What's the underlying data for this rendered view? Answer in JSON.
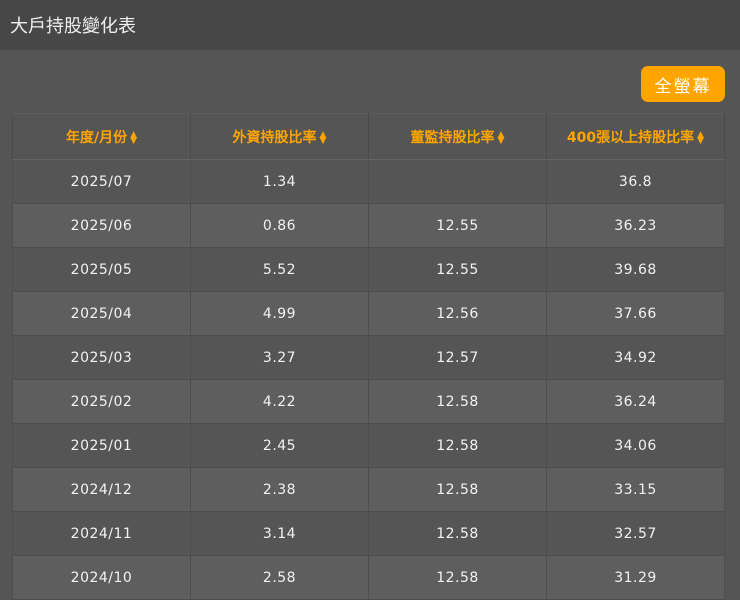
{
  "header": {
    "title": "大戶持股變化表"
  },
  "toolbar": {
    "fullscreen_label": "全螢幕"
  },
  "table": {
    "columns": [
      "年度/月份",
      "外資持股比率",
      "董監持股比率",
      "400張以上持股比率"
    ],
    "rows": [
      [
        "2025/07",
        "1.34",
        "",
        "36.8"
      ],
      [
        "2025/06",
        "0.86",
        "12.55",
        "36.23"
      ],
      [
        "2025/05",
        "5.52",
        "12.55",
        "39.68"
      ],
      [
        "2025/04",
        "4.99",
        "12.56",
        "37.66"
      ],
      [
        "2025/03",
        "3.27",
        "12.57",
        "34.92"
      ],
      [
        "2025/02",
        "4.22",
        "12.58",
        "36.24"
      ],
      [
        "2025/01",
        "2.45",
        "12.58",
        "34.06"
      ],
      [
        "2024/12",
        "2.38",
        "12.58",
        "33.15"
      ],
      [
        "2024/11",
        "3.14",
        "12.58",
        "32.57"
      ],
      [
        "2024/10",
        "2.58",
        "12.58",
        "31.29"
      ]
    ]
  }
}
